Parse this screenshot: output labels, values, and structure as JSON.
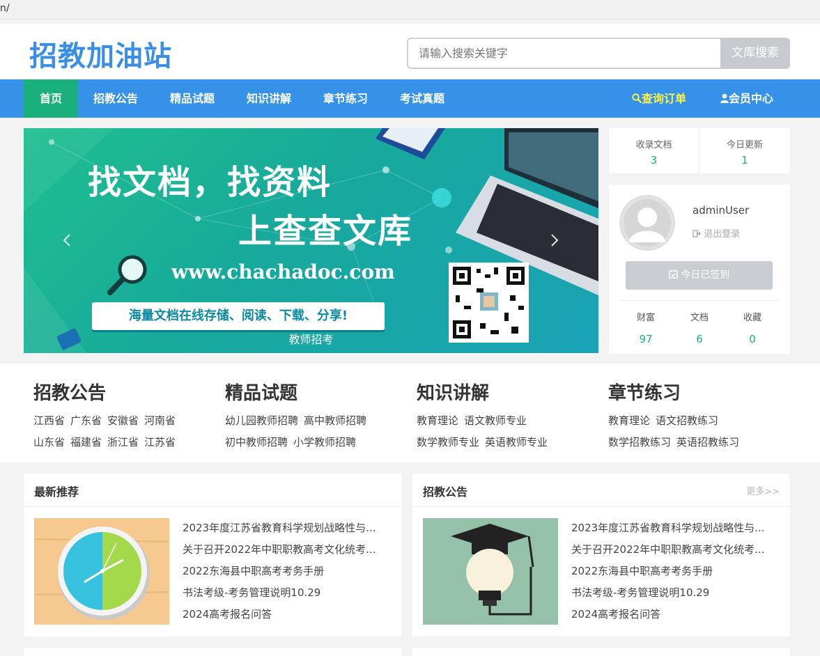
{
  "browser": {
    "url": "n/"
  },
  "header": {
    "logo": "招教加油站",
    "search_placeholder": "请输入搜索关键字",
    "search_button": "文库搜索"
  },
  "nav": {
    "items": [
      {
        "label": "首页"
      },
      {
        "label": "招教公告"
      },
      {
        "label": "精品试题"
      },
      {
        "label": "知识讲解"
      },
      {
        "label": "章节练习"
      },
      {
        "label": "考试真题"
      }
    ],
    "orders": "查询订单",
    "member": "会员中心"
  },
  "banner": {
    "headline1": "找文档，找资料",
    "headline2": "上查查文库",
    "url": "www.chachadoc.com",
    "strip": "海量文档在线存储、阅读、下载、分享!",
    "caption": "教师招考",
    "prev_icon": "chevron-left-icon",
    "next_icon": "chevron-right-icon"
  },
  "stats": {
    "docs_label": "收录文档",
    "docs_value": "3",
    "today_label": "今日更新",
    "today_value": "1"
  },
  "user": {
    "name": "adminUser",
    "logout": "退出登录",
    "signed": "今日已签到",
    "wealth_label": "财富",
    "wealth_value": "97",
    "docs_label": "文档",
    "docs_value": "6",
    "fav_label": "收藏",
    "fav_value": "0"
  },
  "categories": [
    {
      "title": "招教公告",
      "links": [
        "江西省",
        "广东省",
        "安徽省",
        "河南省",
        "山东省",
        "福建省",
        "浙江省",
        "江苏省"
      ]
    },
    {
      "title": "精品试题",
      "links": [
        "幼儿园教师招聘",
        "高中教师招聘",
        "初中教师招聘",
        "小学教师招聘"
      ]
    },
    {
      "title": "知识讲解",
      "links": [
        "教育理论",
        "语文教师专业",
        "数学教师专业",
        "英语教师专业"
      ]
    },
    {
      "title": "章节练习",
      "links": [
        "教育理论",
        "语文招教练习",
        "数学招教练习",
        "英语招教练习"
      ]
    }
  ],
  "panels": [
    {
      "title": "最新推荐",
      "more": "",
      "items": [
        "2023年度江苏省教育科学规划战略性与...",
        "关于召开2022年中职职教高考文化统考...",
        "2022东海县中职高考考务手册",
        "书法考级-考务管理说明10.29",
        "2024高考报名问答"
      ]
    },
    {
      "title": "招教公告",
      "more": "更多>>",
      "items": [
        "2023年度江苏省教育科学规划战略性与...",
        "关于召开2022年中职职教高考文化统考...",
        "2022东海县中职高考考务手册",
        "书法考级-考务管理说明10.29",
        "2024高考报名问答"
      ]
    }
  ],
  "colors": {
    "nav_bg": "#3592e8",
    "nav_active": "#19b07c",
    "accent": "#19b07c",
    "logo": "#3a8ee6",
    "orders": "#fff24a"
  }
}
